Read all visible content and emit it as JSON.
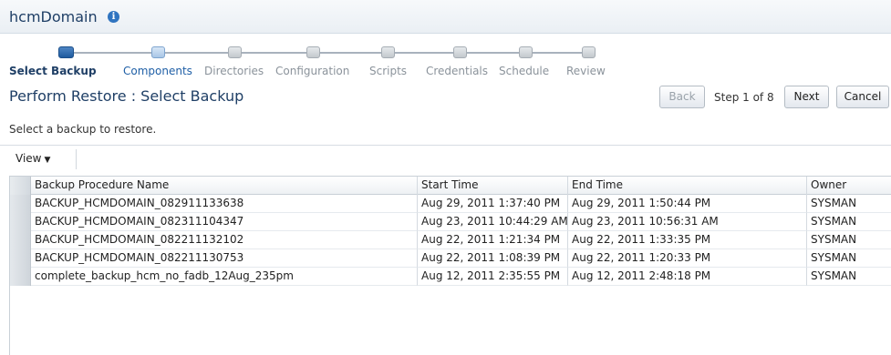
{
  "header": {
    "title": "hcmDomain",
    "info_icon": "info-icon"
  },
  "train": {
    "steps": [
      {
        "label": "Select Backup",
        "state": "current"
      },
      {
        "label": "Components",
        "state": "next"
      },
      {
        "label": "Directories",
        "state": "disabled"
      },
      {
        "label": "Configuration",
        "state": "disabled"
      },
      {
        "label": "Scripts",
        "state": "disabled"
      },
      {
        "label": "Credentials",
        "state": "disabled"
      },
      {
        "label": "Schedule",
        "state": "disabled"
      },
      {
        "label": "Review",
        "state": "disabled"
      }
    ]
  },
  "page": {
    "title": "Perform Restore : Select Backup",
    "instruction": "Select a backup to restore."
  },
  "nav": {
    "back_label": "Back",
    "step_text": "Step 1 of 8",
    "next_label": "Next",
    "cancel_label": "Cancel"
  },
  "toolbar": {
    "view_label": "View",
    "view_caret": "▼"
  },
  "table": {
    "columns": [
      "Backup Procedure Name",
      "Start Time",
      "End Time",
      "Owner"
    ],
    "rows": [
      [
        "BACKUP_HCMDOMAIN_082911133638",
        "Aug 29, 2011 1:37:40 PM",
        "Aug 29, 2011 1:50:44 PM",
        "SYSMAN"
      ],
      [
        "BACKUP_HCMDOMAIN_082311104347",
        "Aug 23, 2011 10:44:29 AM",
        "Aug 23, 2011 10:56:31 AM",
        "SYSMAN"
      ],
      [
        "BACKUP_HCMDOMAIN_082211132102",
        "Aug 22, 2011 1:21:34 PM",
        "Aug 22, 2011 1:33:35 PM",
        "SYSMAN"
      ],
      [
        "BACKUP_HCMDOMAIN_082211130753",
        "Aug 22, 2011 1:08:39 PM",
        "Aug 22, 2011 1:20:33 PM",
        "SYSMAN"
      ],
      [
        "complete_backup_hcm_no_fadb_12Aug_235pm",
        "Aug 12, 2011 2:35:55 PM",
        "Aug 12, 2011 2:48:18 PM",
        "SYSMAN"
      ]
    ]
  }
}
